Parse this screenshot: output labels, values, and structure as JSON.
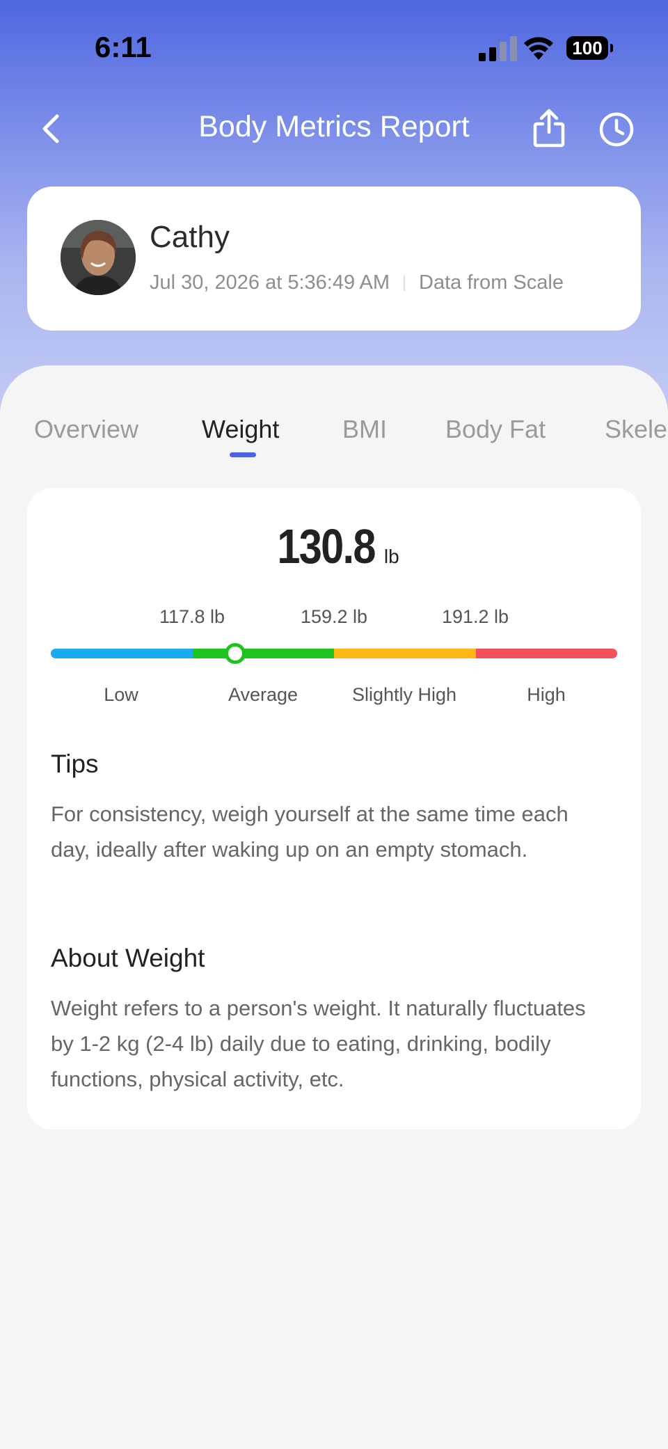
{
  "status_bar": {
    "time": "6:11",
    "battery": "100"
  },
  "nav": {
    "title": "Body Metrics Report",
    "back_icon": "chevron-left-icon",
    "share_icon": "share-icon",
    "history_icon": "clock-icon"
  },
  "profile": {
    "name": "Cathy",
    "timestamp": "Jul 30, 2026 at 5:36:49 AM",
    "source": "Data from Scale"
  },
  "tabs": [
    {
      "label": "Overview",
      "active": false
    },
    {
      "label": "Weight",
      "active": true
    },
    {
      "label": "BMI",
      "active": false
    },
    {
      "label": "Body Fat",
      "active": false
    },
    {
      "label": "Skele",
      "active": false
    }
  ],
  "weight": {
    "value": "130.8",
    "unit": "lb",
    "thresholds": [
      "117.8 lb",
      "159.2 lb",
      "191.2 lb"
    ],
    "ranges": [
      {
        "label": "Low",
        "color": "#1aaaf0"
      },
      {
        "label": "Average",
        "color": "#1ec41e"
      },
      {
        "label": "Slightly High",
        "color": "#fdb814"
      },
      {
        "label": "High",
        "color": "#f2505a"
      }
    ],
    "marker_position_fraction": 0.326
  },
  "tips": {
    "title": "Tips",
    "body": "For consistency, weigh yourself at the same time each day, ideally after waking up on an empty stomach."
  },
  "about": {
    "title": "About Weight",
    "body": "Weight refers to a person's weight. It naturally fluctuates by 1-2 kg (2-4 lb) daily due to eating, drinking, bodily functions, physical activity, etc."
  },
  "colors": {
    "accent": "#4b63e0",
    "header_gradient_top": "#4f67e0"
  }
}
